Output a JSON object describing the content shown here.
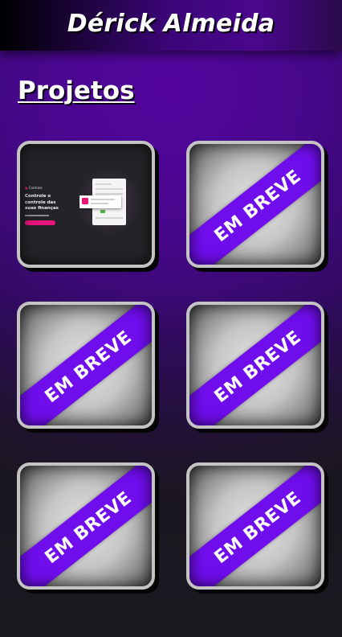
{
  "header": {
    "title": "Dérick Almeida"
  },
  "projects": {
    "section_title": "Projetos",
    "cards": [
      {
        "type": "preview",
        "logo_text": "Controle",
        "headline": "Controle o controle das suas finanças"
      },
      {
        "type": "soon",
        "ribbon": "EM BREVE"
      },
      {
        "type": "soon",
        "ribbon": "EM BREVE"
      },
      {
        "type": "soon",
        "ribbon": "EM BREVE"
      },
      {
        "type": "soon",
        "ribbon": "EM BREVE"
      },
      {
        "type": "soon",
        "ribbon": "EM BREVE"
      }
    ]
  },
  "colors": {
    "ribbon": "#6f0ded",
    "accent": "#e8147a",
    "card_border": "#c4c4c4"
  }
}
